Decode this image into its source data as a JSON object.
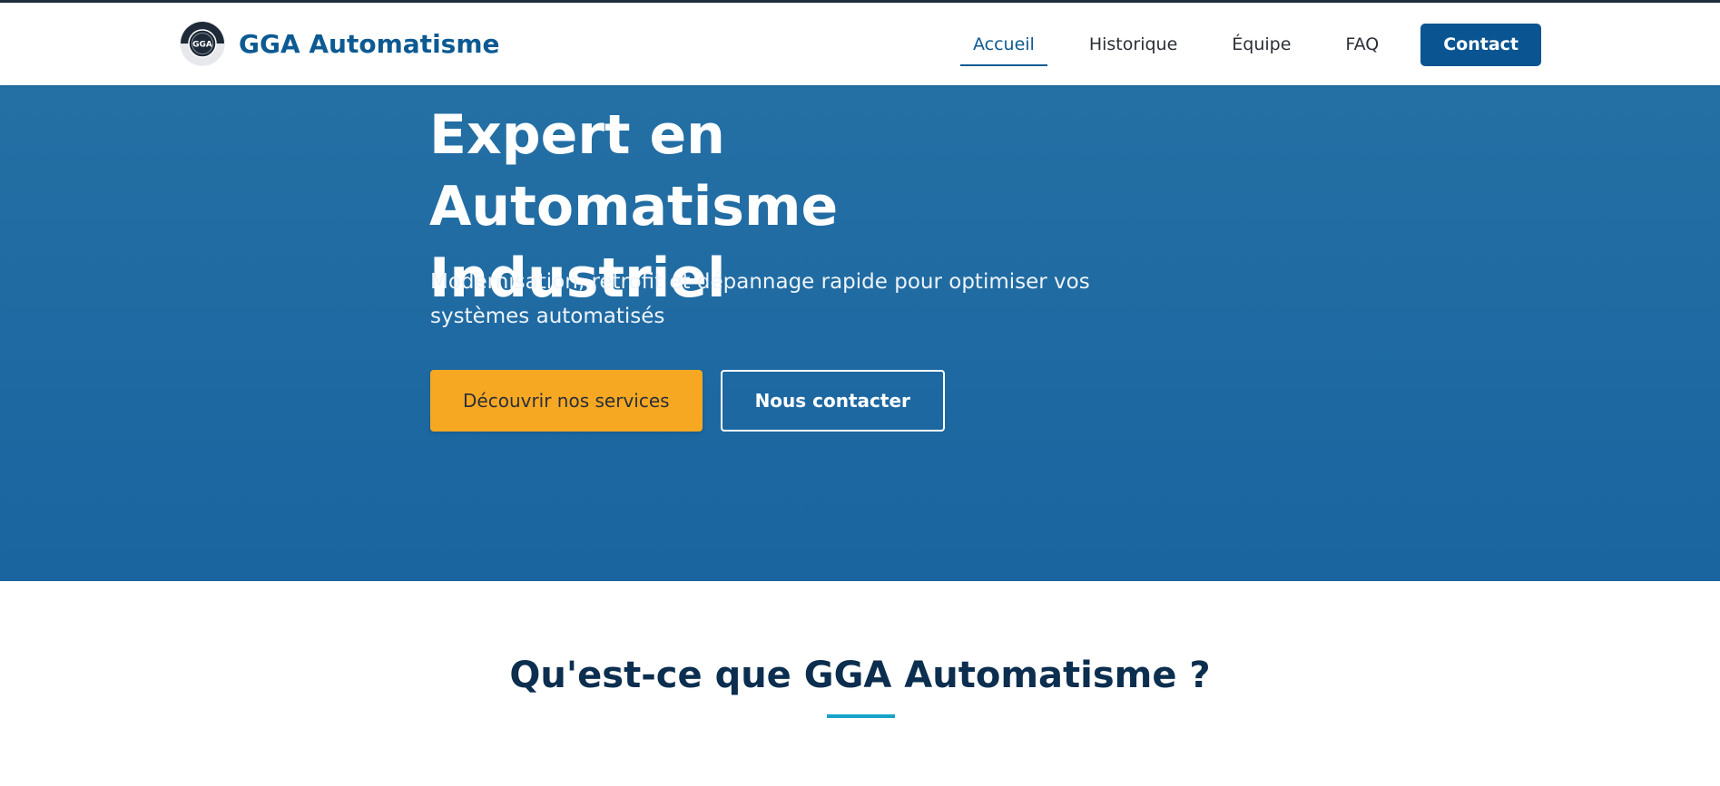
{
  "header": {
    "brand": "GGA Automatisme",
    "logo_text": "GGA",
    "nav": [
      "Accueil",
      "Historique",
      "Équipe",
      "FAQ"
    ],
    "active": "Accueil",
    "contact_label": "Contact"
  },
  "hero": {
    "title_line1": "Expert en Automatisme",
    "title_line2": "Industriel",
    "subtitle": "Modernisation, retrofit et dépannage rapide pour optimiser vos systèmes automatisés",
    "primary_cta": "Découvrir nos services",
    "secondary_cta": "Nous contacter"
  },
  "about": {
    "title": "Qu'est-ce que GGA Automatisme ?"
  },
  "colors": {
    "brand": "#0d5a93",
    "hero_bg": "#1f6aa2",
    "cta_yellow": "#f7a823",
    "accent_cyan": "#17a3c9",
    "heading_dark": "#0c2e4f"
  },
  "icons": [
    "gga-logo-icon"
  ]
}
